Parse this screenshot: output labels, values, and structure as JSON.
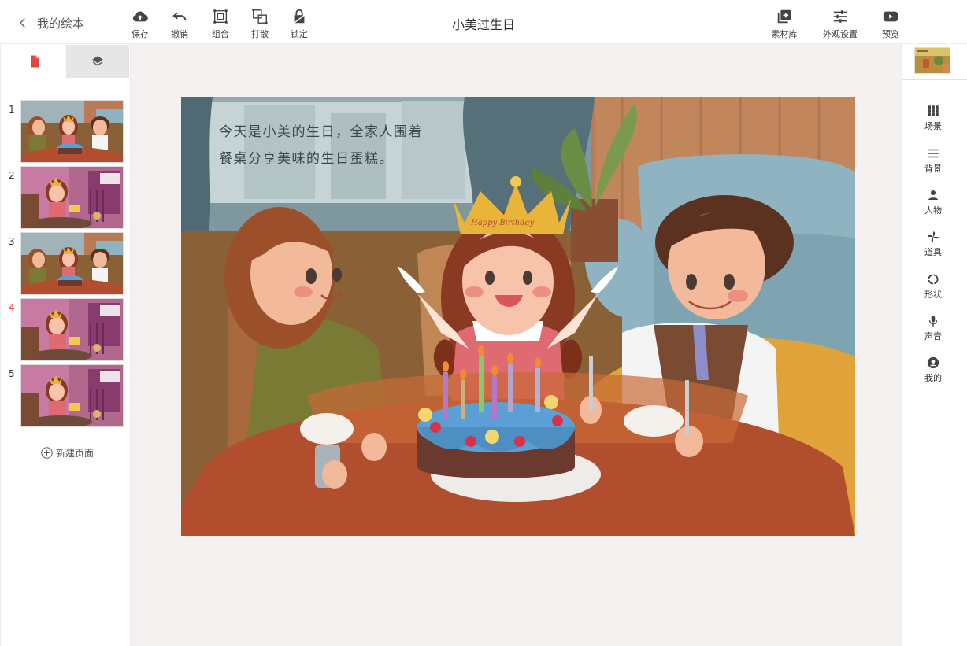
{
  "header": {
    "back_label": "我的绘本",
    "title": "小美过生日"
  },
  "toolbar": {
    "save": "保存",
    "undo": "撤销",
    "group": "组合",
    "ungroup": "打散",
    "lock": "锁定",
    "assets": "素材库",
    "appearance": "外观设置",
    "preview": "预览"
  },
  "left_panel": {
    "pages": [
      {
        "number": "1",
        "scene": "birthday"
      },
      {
        "number": "2",
        "scene": "bedroom"
      },
      {
        "number": "3",
        "scene": "birthday"
      },
      {
        "number": "4",
        "scene": "bedroom"
      },
      {
        "number": "5",
        "scene": "bedroom"
      }
    ],
    "current_page": "4",
    "new_page_label": "新建页面"
  },
  "canvas": {
    "story_line1": "今天是小美的生日，全家人围着",
    "story_line2": "餐桌分享美味的生日蛋糕。",
    "crown_text": "Happy Birthday"
  },
  "right_panel": {
    "items": [
      {
        "label": "场景",
        "icon": "grid-icon"
      },
      {
        "label": "背景",
        "icon": "menu-icon"
      },
      {
        "label": "人物",
        "icon": "person-icon"
      },
      {
        "label": "道具",
        "icon": "pinwheel-icon"
      },
      {
        "label": "形状",
        "icon": "circle-icon"
      },
      {
        "label": "声音",
        "icon": "mic-icon"
      },
      {
        "label": "我的",
        "icon": "account-icon"
      }
    ]
  },
  "colors": {
    "accent": "#e2463d",
    "stage_bg": "#f5f1f0"
  }
}
